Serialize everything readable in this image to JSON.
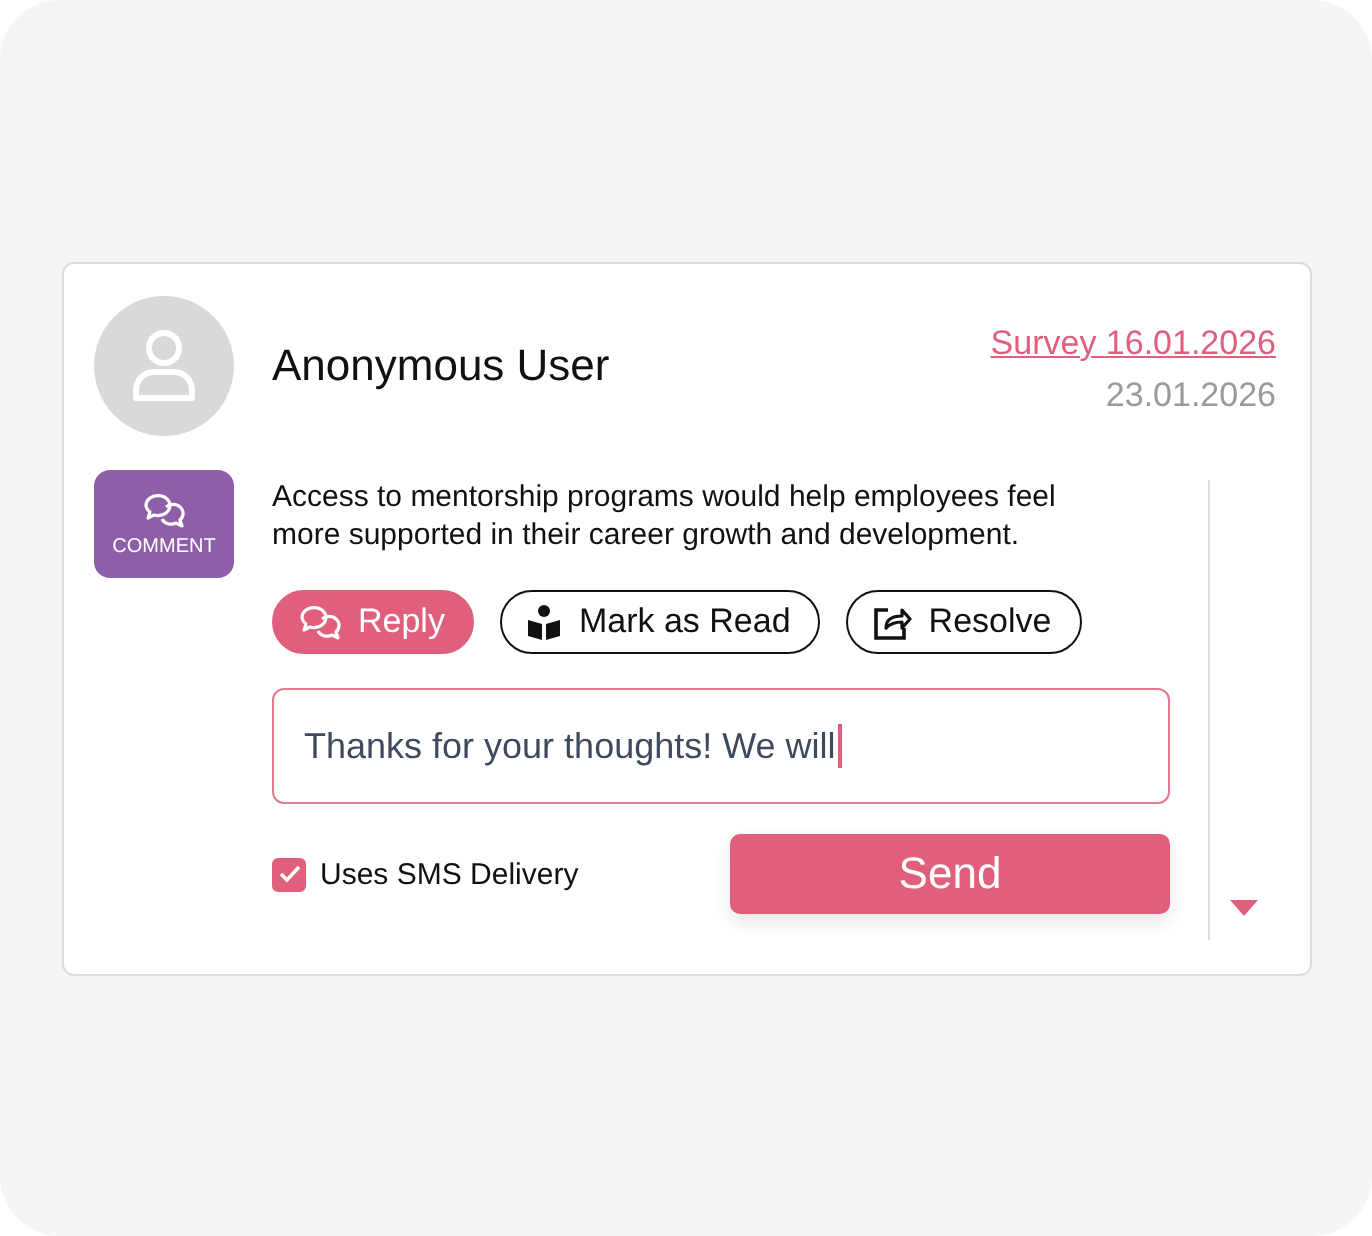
{
  "author": {
    "name": "Anonymous User"
  },
  "survey_link": "Survey 16.01.2026",
  "date": "23.01.2026",
  "badge": {
    "label": "COMMENT"
  },
  "message": "Access to mentorship programs would help employees feel more supported in their career growth and development.",
  "actions": [
    {
      "label": "Reply",
      "kind": "reply",
      "selected": true
    },
    {
      "label": "Mark as Read",
      "kind": "read",
      "selected": false
    },
    {
      "label": "Resolve",
      "kind": "resolve",
      "selected": false
    }
  ],
  "reply_field": {
    "value": "Thanks for your thoughts! We will",
    "focused": true
  },
  "sms_option": {
    "label": "Uses SMS Delivery",
    "checked": true
  },
  "send_button": "Send"
}
